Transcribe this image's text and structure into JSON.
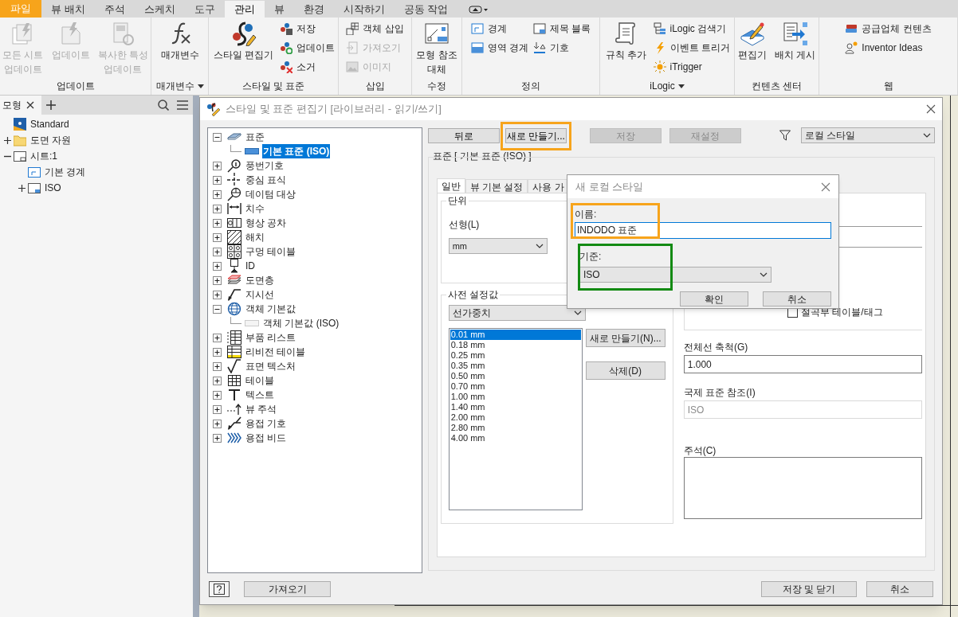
{
  "ribbon_tabs": [
    {
      "label": "파일",
      "kind": "file"
    },
    {
      "label": "뷰 배치",
      "kind": "tab",
      "selected": false
    },
    {
      "label": "주석",
      "kind": "tab",
      "selected": false
    },
    {
      "label": "스케치",
      "kind": "tab",
      "selected": false
    },
    {
      "label": "도구",
      "kind": "tab",
      "selected": false
    },
    {
      "label": "관리",
      "kind": "tab",
      "selected": true
    },
    {
      "label": "뷰",
      "kind": "tab",
      "selected": false
    },
    {
      "label": "환경",
      "kind": "tab",
      "selected": false
    },
    {
      "label": "시작하기",
      "kind": "tab",
      "selected": false
    },
    {
      "label": "공동 작업",
      "kind": "tab",
      "selected": false
    }
  ],
  "ribbon_groups": [
    {
      "label": "업데이트",
      "columns": [
        {
          "kind": "large",
          "lines": [
            "모든 시트",
            "업데이트"
          ],
          "disabled": true
        },
        {
          "kind": "large",
          "lines": [
            "업데이트"
          ],
          "disabled": true
        },
        {
          "kind": "large",
          "lines": [
            "복사한 특성",
            "업데이트"
          ],
          "disabled": true
        }
      ]
    },
    {
      "label": "매개변수",
      "menu": true,
      "columns": [
        {
          "kind": "large",
          "lines": [
            "매개변수"
          ],
          "disabled": false
        }
      ]
    },
    {
      "label": "스타일 및 표준",
      "columns": [
        {
          "kind": "large",
          "lines": [
            "스타일 편집기"
          ],
          "disabled": false
        },
        {
          "kind": "stack",
          "items": [
            {
              "label": "저장",
              "disabled": false
            },
            {
              "label": "업데이트",
              "disabled": false
            },
            {
              "label": "소거",
              "disabled": false
            }
          ]
        }
      ]
    },
    {
      "label": "삽입",
      "columns": [
        {
          "kind": "stack",
          "items": [
            {
              "label": "객체 삽입",
              "disabled": false
            },
            {
              "label": "가져오기",
              "disabled": true
            },
            {
              "label": "이미지",
              "disabled": true
            }
          ]
        }
      ]
    },
    {
      "label": "수정",
      "columns": [
        {
          "kind": "large",
          "lines": [
            "모형 참조",
            "대체"
          ],
          "disabled": false
        }
      ]
    },
    {
      "label": "정의",
      "columns": [
        {
          "kind": "stack",
          "items": [
            {
              "label": "경계",
              "disabled": false
            },
            {
              "label": "영역 경계",
              "disabled": false
            }
          ]
        },
        {
          "kind": "stack",
          "items": [
            {
              "label": "제목 블록",
              "disabled": false
            },
            {
              "label": "기호",
              "disabled": false
            }
          ]
        }
      ]
    },
    {
      "label": "iLogic",
      "menu": true,
      "columns": [
        {
          "kind": "large",
          "lines": [
            "규칙 추가"
          ],
          "disabled": false
        },
        {
          "kind": "stack",
          "items": [
            {
              "label": "iLogic 검색기",
              "disabled": false
            },
            {
              "label": "이벤트 트리거",
              "disabled": false
            },
            {
              "label": "iTrigger",
              "disabled": false
            }
          ]
        }
      ]
    },
    {
      "label": "컨텐츠 센터",
      "columns": [
        {
          "kind": "large",
          "lines": [
            "편집기"
          ],
          "disabled": false
        },
        {
          "kind": "large",
          "lines": [
            "배치 게시"
          ],
          "disabled": false
        }
      ]
    },
    {
      "label": "웹",
      "columns": [
        {
          "kind": "stack",
          "items": [
            {
              "label": "공급업체 컨텐츠",
              "disabled": false
            },
            {
              "label": "Inventor Ideas",
              "disabled": false
            }
          ]
        }
      ]
    }
  ],
  "browser": {
    "tab": "모형",
    "tree": [
      {
        "label": "Standard"
      },
      {
        "label": "도면 자원",
        "expanded": false
      },
      {
        "label": "시트:1",
        "expanded": true,
        "children": [
          {
            "label": "기본 경계"
          },
          {
            "label": "ISO",
            "expanded": false
          }
        ]
      }
    ]
  },
  "style_editor": {
    "title": "스타일 및 표준 편집기 [라이브러리 - 읽기/쓰기]",
    "tree": [
      {
        "label": "표준",
        "expanded": true,
        "selected": false,
        "children": [
          {
            "label": "기본 표준 (ISO)",
            "selected": true
          }
        ]
      },
      {
        "label": "풍번기호",
        "expanded": false,
        "selected": false
      },
      {
        "label": "중심 표식",
        "expanded": false,
        "selected": false
      },
      {
        "label": "데이텀 대상",
        "expanded": false,
        "selected": false
      },
      {
        "label": "치수",
        "expanded": false,
        "selected": false
      },
      {
        "label": "형상 공차",
        "expanded": false,
        "selected": false
      },
      {
        "label": "해치",
        "expanded": false,
        "selected": false
      },
      {
        "label": "구멍 테이블",
        "expanded": false,
        "selected": false
      },
      {
        "label": "ID",
        "expanded": false,
        "selected": false
      },
      {
        "label": "도면층",
        "expanded": false,
        "selected": false
      },
      {
        "label": "지시선",
        "expanded": false,
        "selected": false
      },
      {
        "label": "객체 기본값",
        "expanded": true,
        "selected": false,
        "children": [
          {
            "label": "객체 기본값 (ISO)",
            "selected": false
          }
        ]
      },
      {
        "label": "부품 리스트",
        "expanded": false,
        "selected": false
      },
      {
        "label": "리비전 테이블",
        "expanded": false,
        "selected": false
      },
      {
        "label": "표면 텍스처",
        "expanded": false,
        "selected": false
      },
      {
        "label": "테이블",
        "expanded": false,
        "selected": false
      },
      {
        "label": "텍스트",
        "expanded": false,
        "selected": false
      },
      {
        "label": "뷰 주석",
        "expanded": false,
        "selected": false
      },
      {
        "label": "용접 기호",
        "expanded": false,
        "selected": false
      },
      {
        "label": "용접 비드",
        "expanded": false,
        "selected": false
      }
    ],
    "toolbar": [
      {
        "label": "뒤로",
        "disabled": false,
        "highlight": false
      },
      {
        "label": "새로 만들기...",
        "disabled": false,
        "highlight": true,
        "color": "#f7a41b"
      },
      {
        "label": "저장",
        "disabled": true,
        "highlight": false
      },
      {
        "label": "재설정",
        "disabled": true,
        "highlight": false
      }
    ],
    "filter": "로컬 스타일",
    "group_title": "표준 [ 기본 표준 (ISO) ]",
    "tabs": [
      {
        "label": "일반",
        "selected": true
      },
      {
        "label": "뷰 기본 설정",
        "selected": false
      },
      {
        "label": "사용 가",
        "selected": false
      }
    ],
    "units": {
      "title": "단위",
      "linear_label": "선형(L)",
      "linear_value": "mm"
    },
    "presets": {
      "title": "사전 설정값",
      "type": "선가중치",
      "items": [
        {
          "label": "0.01 mm",
          "selected": true
        },
        {
          "label": "0.18 mm",
          "selected": false
        },
        {
          "label": "0.25 mm",
          "selected": false
        },
        {
          "label": "0.35 mm",
          "selected": false
        },
        {
          "label": "0.50 mm",
          "selected": false
        },
        {
          "label": "0.70 mm",
          "selected": false
        },
        {
          "label": "1.00 mm",
          "selected": false
        },
        {
          "label": "1.40 mm",
          "selected": false
        },
        {
          "label": "2.00 mm",
          "selected": false
        },
        {
          "label": "2.80 mm",
          "selected": false
        },
        {
          "label": "4.00 mm",
          "selected": false
        }
      ],
      "buttons": [
        "새로 만들기(N)...",
        "삭제(D)"
      ]
    },
    "bend_table": {
      "label": "절곡부 테이블/태그",
      "checked": false
    },
    "scale": {
      "label": "전체선 축척(G)",
      "value": "1.000"
    },
    "standard_ref": {
      "label": "국제 표준 참조(I)",
      "value": "ISO",
      "disabled": true
    },
    "notes": {
      "label": "주석(C)"
    },
    "footer_left": [
      "가져오기"
    ],
    "footer_right": [
      "저장 및 닫기",
      "취소"
    ]
  },
  "new_style_dialog": {
    "title": "새 로컬 스타일",
    "fields": [
      {
        "kind": "text",
        "label": "이름:",
        "value": "INDODO 표준",
        "highlight": true,
        "color": "#f7a41b"
      },
      {
        "kind": "dropdown",
        "label": "기준:",
        "value": "ISO",
        "highlight": true,
        "color": "#138a13"
      }
    ],
    "buttons": [
      "확인",
      "취소"
    ]
  }
}
